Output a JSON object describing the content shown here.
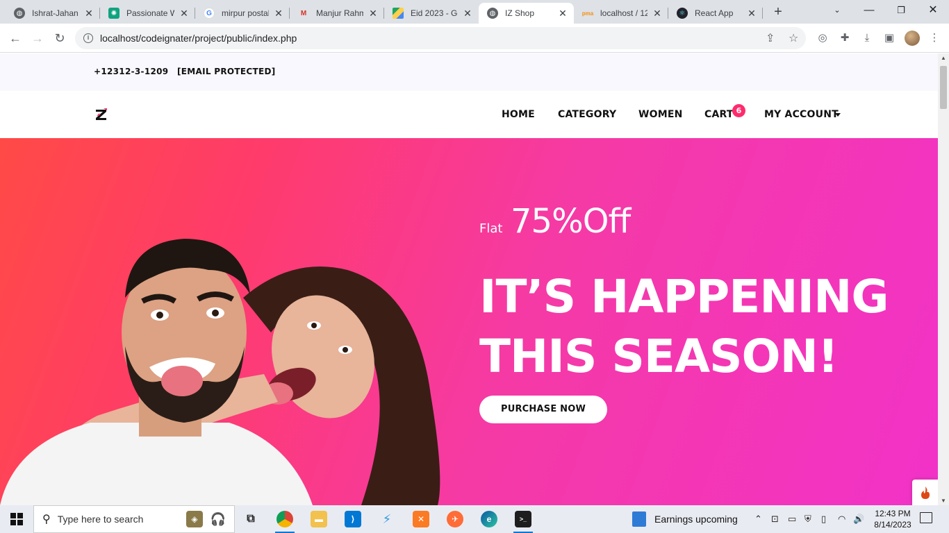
{
  "browser": {
    "tabs": [
      {
        "title": "Ishrat-Jahan",
        "favicon": "globe-icon",
        "active": false
      },
      {
        "title": "Passionate W",
        "favicon": "chatgpt-icon",
        "active": false
      },
      {
        "title": "mirpur postal",
        "favicon": "google-icon",
        "active": false
      },
      {
        "title": "Manjur Rahm",
        "favicon": "m-logo-icon",
        "active": false
      },
      {
        "title": "Eid 2023 - Go",
        "favicon": "drive-icon",
        "active": false
      },
      {
        "title": "IZ Shop",
        "favicon": "globe-icon",
        "active": true
      },
      {
        "title": "localhost / 12",
        "favicon": "phpmyadmin-icon",
        "active": false
      },
      {
        "title": "React App",
        "favicon": "react-icon",
        "active": false
      }
    ],
    "url": "localhost/codeignater/project/public/index.php"
  },
  "topbar": {
    "phone": "+12312-3-1209",
    "email": "[EMAIL PROTECTED]"
  },
  "nav": {
    "home": "HOME",
    "category": "CATEGORY",
    "women": "WOMEN",
    "cart": "CART",
    "cart_count": "6",
    "account": "MY ACCOUNT"
  },
  "hero": {
    "flat_label": "Flat",
    "discount": "75%Off",
    "headline_line1": "IT’S HAPPENING",
    "headline_line2": "THIS SEASON!",
    "cta": "PURCHASE NOW"
  },
  "taskbar": {
    "search_placeholder": "Type here to search",
    "news": "Earnings upcoming",
    "time": "12:43 PM",
    "date": "8/14/2023"
  },
  "colors": {
    "accent": "#ff2a6d",
    "hero_start": "#ff4a46",
    "hero_end": "#f232c8"
  }
}
